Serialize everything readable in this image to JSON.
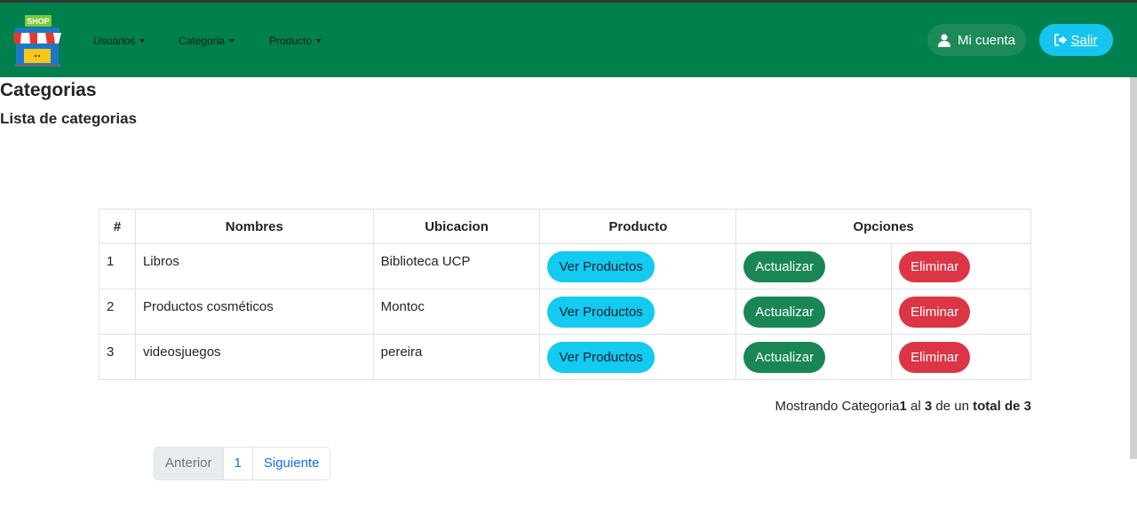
{
  "brand": {
    "logo_text": "SHOP"
  },
  "nav": {
    "items": [
      "Usuarios",
      "Categoria",
      "Producto"
    ]
  },
  "header_buttons": {
    "account_label": "Mi cuenta",
    "exit_label": "Salir"
  },
  "page": {
    "title": "Categorias",
    "subtitle": "Lista de categorias"
  },
  "table": {
    "headers": [
      "#",
      "Nombres",
      "Ubicacion",
      "Producto",
      "Opciones"
    ],
    "rows": [
      {
        "num": "1",
        "name": "Libros",
        "location": "Biblioteca UCP"
      },
      {
        "num": "2",
        "name": "Productos cosméticos",
        "location": "Montoc"
      },
      {
        "num": "3",
        "name": "videosjuegos",
        "location": "pereira"
      }
    ],
    "view_label": "Ver Productos",
    "update_label": "Actualizar",
    "delete_label": "Eliminar"
  },
  "summary": {
    "prefix": "Mostrando Categoria",
    "from": "1",
    "middle": "al",
    "to": "3",
    "of": "de un",
    "total": "total de 3"
  },
  "pagination": {
    "prev": "Anterior",
    "page": "1",
    "next": "Siguiente"
  },
  "colors": {
    "navbar": "#00804d",
    "info": "#13caf0",
    "success": "#198754",
    "danger": "#dc3545"
  }
}
